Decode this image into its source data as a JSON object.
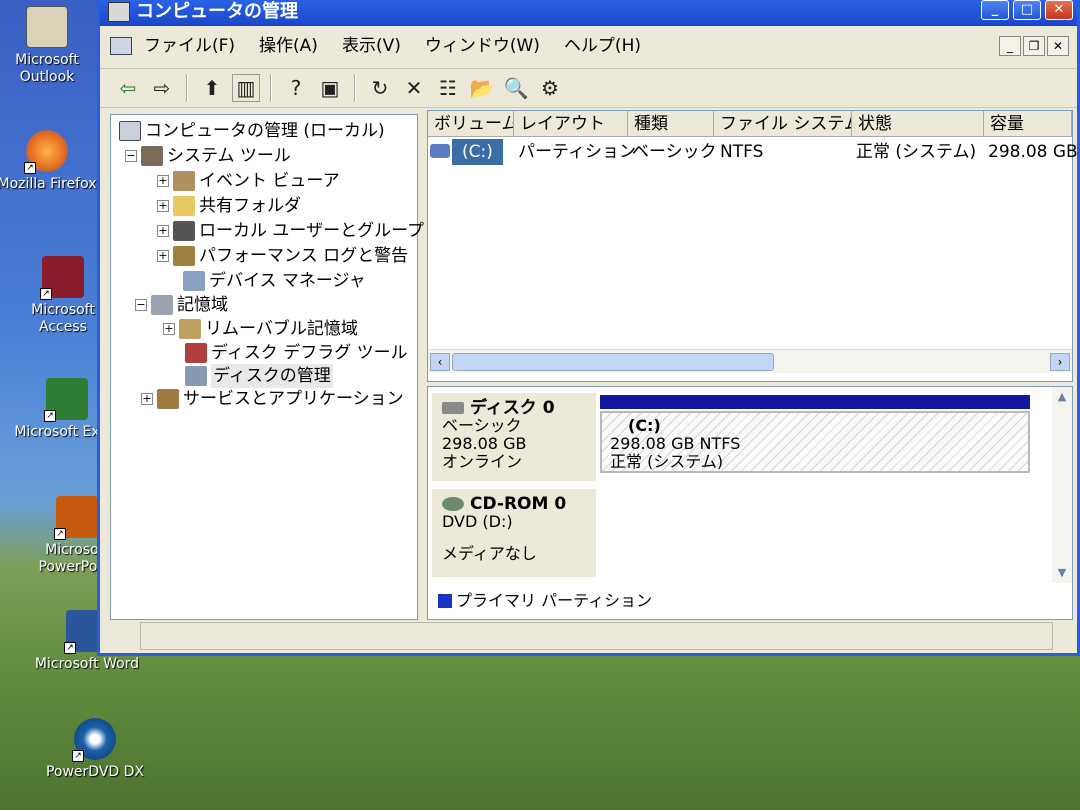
{
  "desktop_icons": [
    {
      "label": "Microsoft Outlook",
      "icon": "outlook-icon",
      "color": "#d9d2b9"
    },
    {
      "label": "Mozilla Firefox",
      "icon": "firefox-icon",
      "color": "#e36a1e"
    },
    {
      "label": "Microsoft Access",
      "icon": "access-icon",
      "color": "#8b1c2b"
    },
    {
      "label": "Microsoft Excel",
      "icon": "excel-icon",
      "color": "#2e7d32"
    },
    {
      "label": "Microsoft PowerPoint",
      "icon": "powerpoint-icon",
      "color": "#c55a11"
    },
    {
      "label": "Microsoft Word",
      "icon": "word-icon",
      "color": "#2b579a"
    },
    {
      "label": "PowerDVD DX",
      "icon": "powerdvd-icon",
      "color": "#1a5fa8"
    }
  ],
  "window": {
    "title": "コンピュータの管理",
    "menu": [
      "ファイル(F)",
      "操作(A)",
      "表示(V)",
      "ウィンドウ(W)",
      "ヘルプ(H)"
    ]
  },
  "tree": {
    "root": "コンピュータの管理 (ローカル)",
    "system_tools": "システム ツール",
    "event_viewer": "イベント ビューア",
    "shared_folders": "共有フォルダ",
    "local_users": "ローカル ユーザーとグループ",
    "perf_logs": "パフォーマンス ログと警告",
    "device_manager": "デバイス マネージャ",
    "storage": "記憶域",
    "removable": "リムーバブル記憶域",
    "defrag": "ディスク デフラグ ツール",
    "disk_mgmt": "ディスクの管理",
    "services": "サービスとアプリケーション"
  },
  "volume_list": {
    "columns": [
      "ボリューム",
      "レイアウト",
      "種類",
      "ファイル システム",
      "状態",
      "容量"
    ],
    "rows": [
      {
        "volume": "(C:)",
        "layout": "パーティション",
        "type": "ベーシック",
        "fs": "NTFS",
        "status": "正常 (システム)",
        "capacity": "298.08 GB"
      }
    ]
  },
  "disks": {
    "disk0": {
      "name": "ディスク 0",
      "type": "ベーシック",
      "size": "298.08 GB",
      "state": "オンライン"
    },
    "partition": {
      "label": "(C:)",
      "detail": "298.08 GB NTFS",
      "status": "正常 (システム)"
    },
    "cdrom": {
      "name": "CD-ROM 0",
      "drive": "DVD (D:)",
      "media": "メディアなし"
    }
  },
  "legend": {
    "label": "プライマリ パーティション",
    "color": "#1a33c7"
  }
}
